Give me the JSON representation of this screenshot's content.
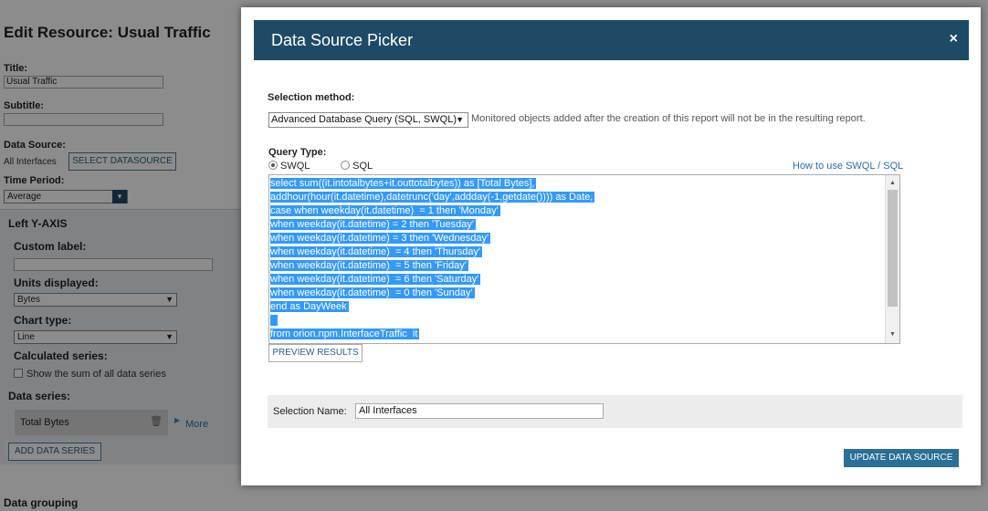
{
  "background": {
    "page_title": "Edit Resource: Usual Traffic",
    "title_label": "Title:",
    "title_value": "Usual Traffic",
    "subtitle_label": "Subtitle:",
    "subtitle_value": "",
    "datasource_label": "Data Source:",
    "datasource_value": "All Interfaces",
    "select_datasource_btn": "SELECT DATASOURCE",
    "time_period_label": "Time Period:",
    "time_period_value": "Average",
    "left_axis_label": "Left Y-AXIS",
    "custom_label_label": "Custom label:",
    "custom_label_value": "",
    "units_label": "Units displayed:",
    "units_value": "Bytes",
    "chart_type_label": "Chart type:",
    "chart_type_value": "Line",
    "calculated_label": "Calculated series:",
    "show_sum_label": "Show the sum of all data series",
    "data_series_label": "Data series:",
    "series_item": "Total Bytes",
    "more_link": "More",
    "add_series_btn": "ADD DATA SERIES",
    "grouping_label": "Data grouping"
  },
  "dialog": {
    "title": "Data Source Picker",
    "close_glyph": "×",
    "selection_method_label": "Selection method:",
    "selection_method_value": "Advanced Database Query (SQL, SWQL)",
    "selection_note": "Monitored objects added after the creation of this report will not be in the resulting report.",
    "query_type_label": "Query Type:",
    "query_type_options": [
      "SWQL",
      "SQL"
    ],
    "help_link": "How to use SWQL / SQL",
    "query_lines": [
      "select sum((it.intotalbytes+it.outtotalbytes)) as [Total Bytes],",
      "addhour(hour(it.datetime),datetrunc('day',addday(-1,getdate()))) as Date,",
      "case when weekday(it.datetime)  = 1 then 'Monday'",
      "when weekday(it.datetime) = 2 then 'Tuesday'",
      "when weekday(it.datetime) = 3 then 'Wednesday'",
      "when weekday(it.datetime)  = 4 then 'Thursday'",
      "when weekday(it.datetime)  = 5 then 'Friday'",
      "when weekday(it.datetime)  = 6 then 'Saturday'",
      "when weekday(it.datetime)  = 0 then 'Sunday'",
      "end as DayWeek",
      "  ",
      "from orion.npm.InterfaceTraffic  it"
    ],
    "preview_btn": "PREVIEW RESULTS",
    "selection_name_label": "Selection Name:",
    "selection_name_value": "All Interfaces",
    "update_btn": "UPDATE DATA SOURCE"
  }
}
